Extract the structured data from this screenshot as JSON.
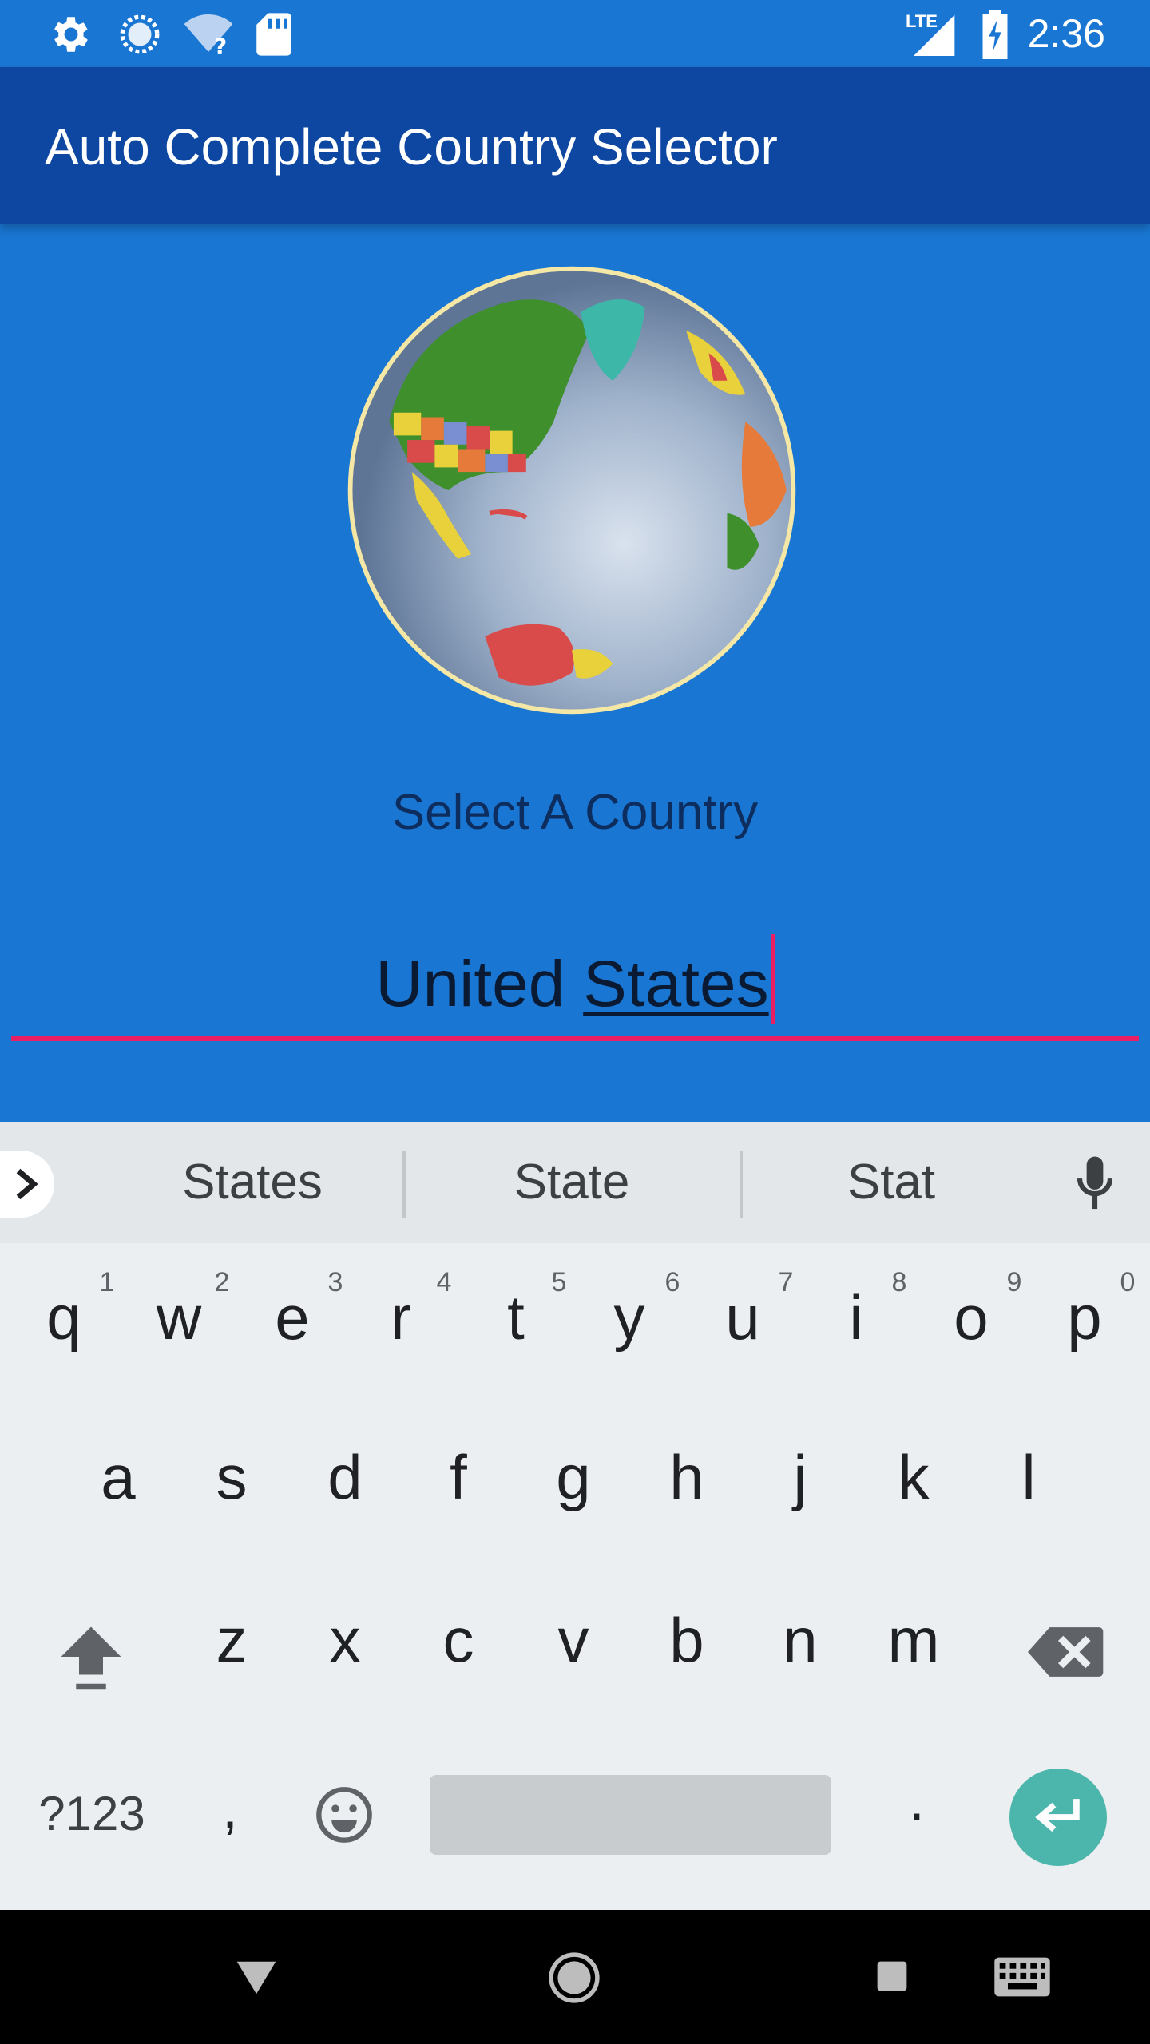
{
  "status_bar": {
    "time": "2:36",
    "network": "LTE"
  },
  "app_bar": {
    "title": "Auto Complete Country Selector"
  },
  "main": {
    "select_label": "Select A Country",
    "input_prefix": "United ",
    "input_composing": "States"
  },
  "keyboard": {
    "suggestions": [
      "States",
      "State",
      "Stat"
    ],
    "row1": [
      "q",
      "w",
      "e",
      "r",
      "t",
      "y",
      "u",
      "i",
      "o",
      "p"
    ],
    "row1_hints": [
      "1",
      "2",
      "3",
      "4",
      "5",
      "6",
      "7",
      "8",
      "9",
      "0"
    ],
    "row2": [
      "a",
      "s",
      "d",
      "f",
      "g",
      "h",
      "j",
      "k",
      "l"
    ],
    "row3": [
      "z",
      "x",
      "c",
      "v",
      "b",
      "n",
      "m"
    ],
    "symbols_label": "?123",
    "comma_label": ",",
    "period_label": "."
  },
  "colors": {
    "primary": "#1976D2",
    "primary_dark": "#0D47A1",
    "accent": "#E91E63",
    "enter_key": "#4DB6AC"
  }
}
